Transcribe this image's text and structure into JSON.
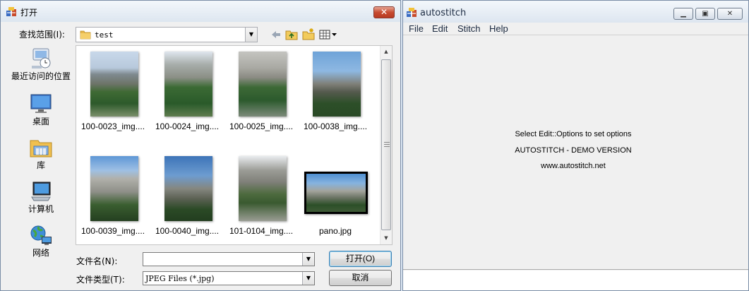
{
  "dialog": {
    "title": "打开",
    "close_label": "✕",
    "look_in_label": "查找范围(I):",
    "look_in_value": "test",
    "places": [
      {
        "label": "最近访问的位置",
        "icon": "recent-places-icon"
      },
      {
        "label": "桌面",
        "icon": "desktop-icon"
      },
      {
        "label": "库",
        "icon": "libraries-icon"
      },
      {
        "label": "计算机",
        "icon": "computer-icon"
      },
      {
        "label": "网络",
        "icon": "network-icon"
      }
    ],
    "files": [
      {
        "name": "100-0023_img...."
      },
      {
        "name": "100-0024_img...."
      },
      {
        "name": "100-0025_img...."
      },
      {
        "name": "100-0038_img...."
      },
      {
        "name": "100-0039_img...."
      },
      {
        "name": "100-0040_img...."
      },
      {
        "name": "101-0104_img...."
      },
      {
        "name": "pano.jpg"
      }
    ],
    "file_name_label": "文件名(N):",
    "file_name_value": "",
    "file_type_label": "文件类型(T):",
    "file_type_value": "JPEG Files (*.jpg)",
    "open_button": "打开(O)",
    "cancel_button": "取消"
  },
  "app": {
    "title": "autostitch",
    "menu": [
      "File",
      "Edit",
      "Stitch",
      "Help"
    ],
    "messages": [
      "Select Edit::Options to set options",
      "AUTOSTITCH - DEMO VERSION",
      "www.autostitch.net"
    ]
  }
}
